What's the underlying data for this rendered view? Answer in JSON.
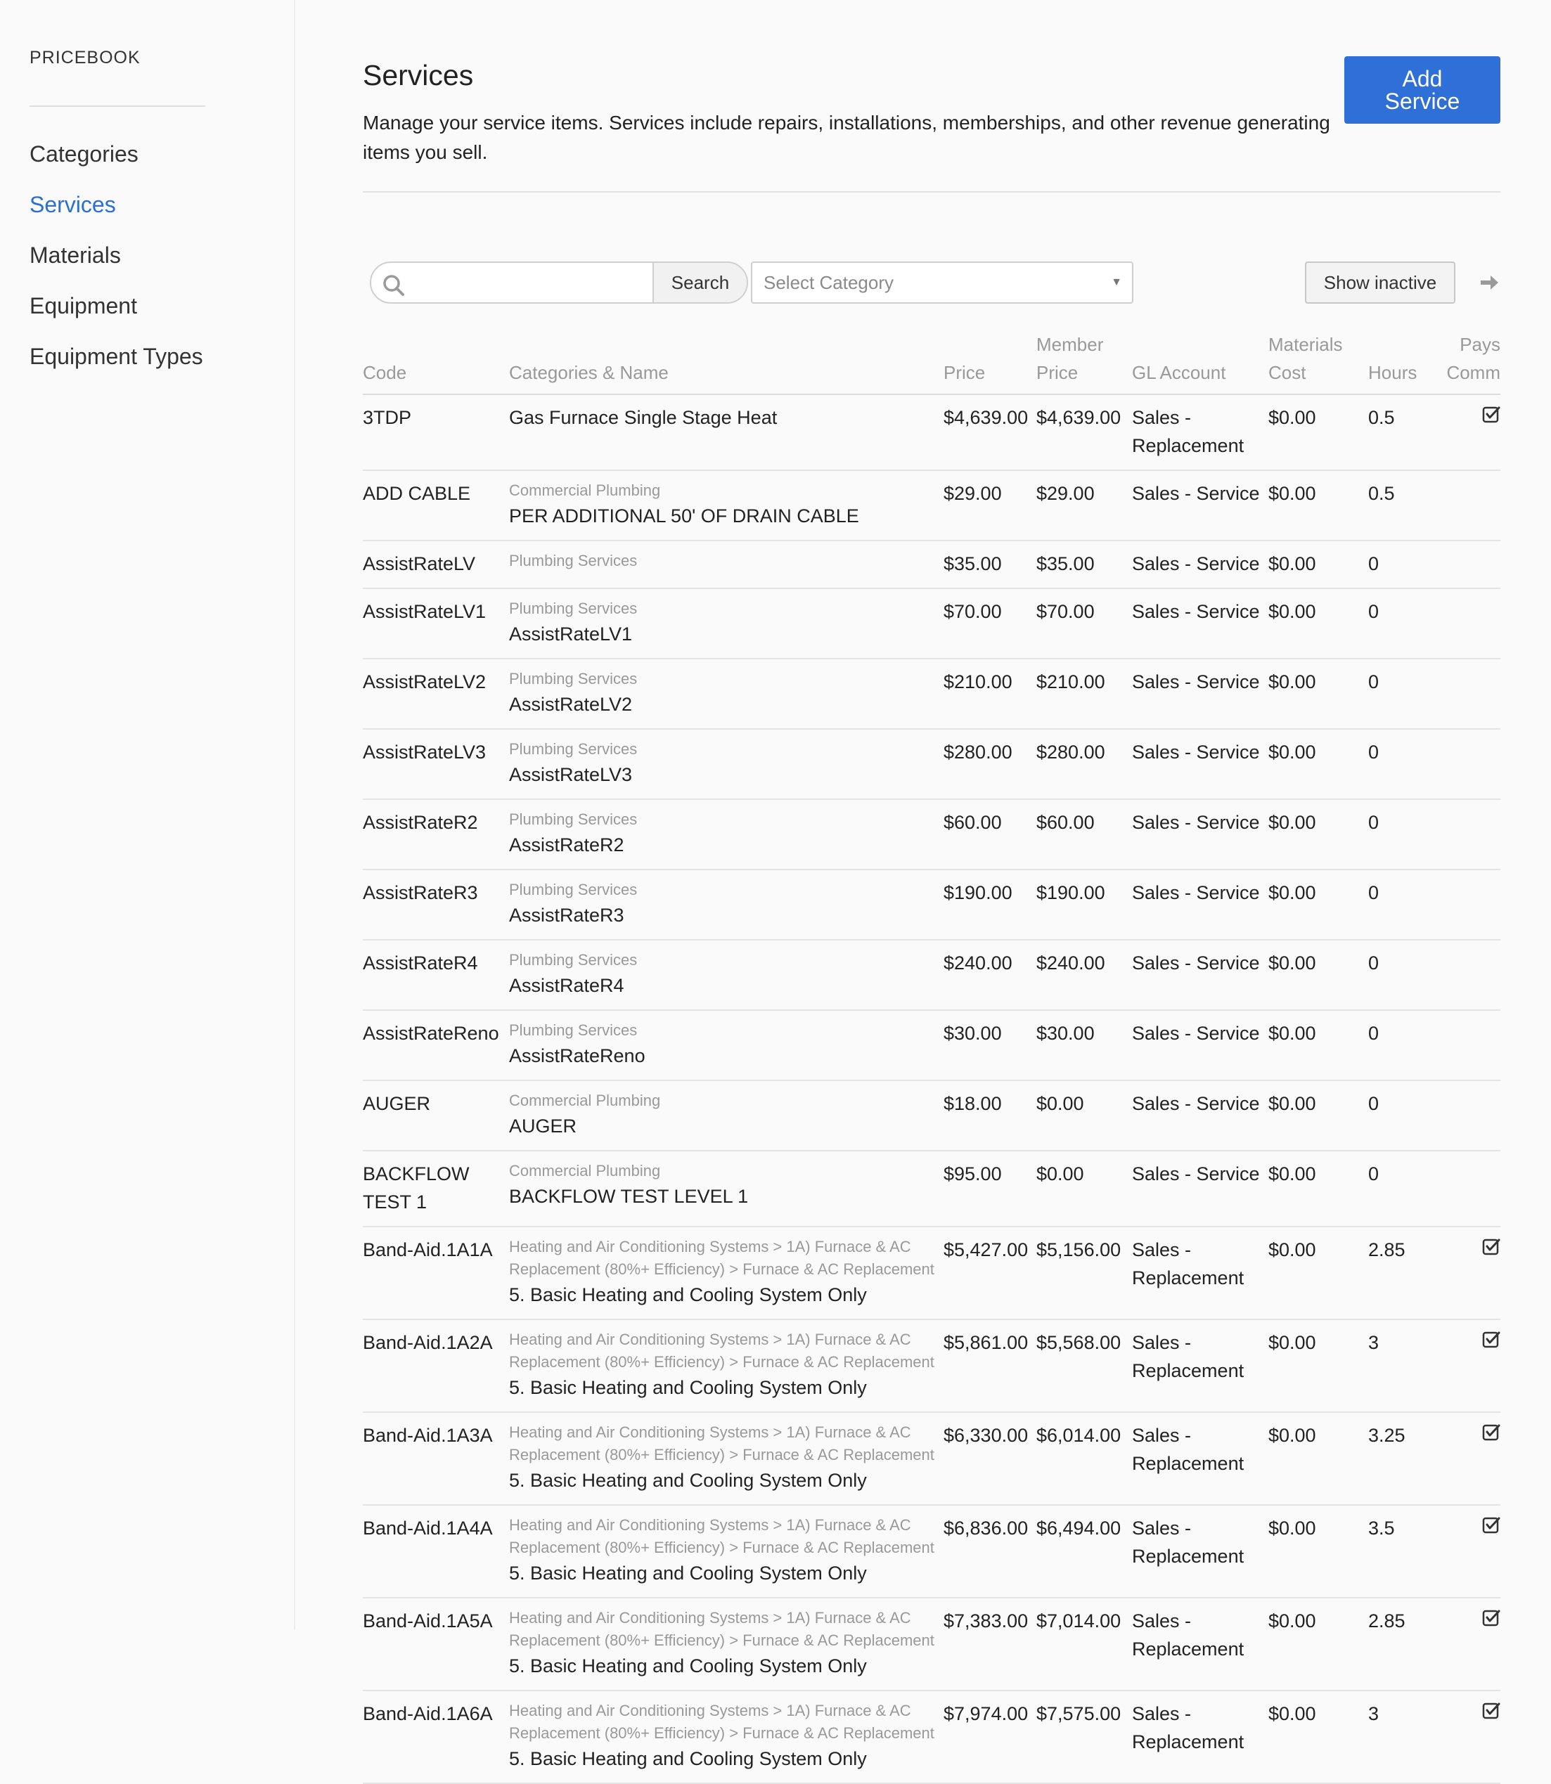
{
  "sidebar": {
    "brand": "PRICEBOOK",
    "items": [
      {
        "label": "Categories",
        "active": false
      },
      {
        "label": "Services",
        "active": true
      },
      {
        "label": "Materials",
        "active": false
      },
      {
        "label": "Equipment",
        "active": false
      },
      {
        "label": "Equipment Types",
        "active": false
      }
    ]
  },
  "header": {
    "title": "Services",
    "description": "Manage your service items. Services include repairs, installations, memberships, and other revenue generating items you sell.",
    "add_button": "Add Service"
  },
  "toolbar": {
    "search_value": "",
    "search_button": "Search",
    "category_placeholder": "Select Category",
    "show_inactive": "Show inactive"
  },
  "table": {
    "columns": {
      "code": "Code",
      "name": "Categories & Name",
      "price": "Price",
      "member_price": "Member Price",
      "gl_account": "GL Account",
      "materials_cost": "Materials Cost",
      "hours": "Hours",
      "pays_comm": "Pays Comm"
    },
    "rows": [
      {
        "code": "3TDP",
        "category": "",
        "name": "Gas Furnace Single Stage Heat",
        "price": "$4,639.00",
        "member": "$4,639.00",
        "gl": "Sales - Replacement",
        "mat": "$0.00",
        "hours": "0.5",
        "comm": true
      },
      {
        "code": "ADD CABLE",
        "category": "Commercial Plumbing",
        "name": "PER ADDITIONAL 50' OF DRAIN CABLE",
        "price": "$29.00",
        "member": "$29.00",
        "gl": "Sales - Service",
        "mat": "$0.00",
        "hours": "0.5",
        "comm": false
      },
      {
        "code": "AssistRateLV",
        "category": "Plumbing Services",
        "name": "",
        "price": "$35.00",
        "member": "$35.00",
        "gl": "Sales - Service",
        "mat": "$0.00",
        "hours": "0",
        "comm": false
      },
      {
        "code": "AssistRateLV1",
        "category": "Plumbing Services",
        "name": "AssistRateLV1",
        "price": "$70.00",
        "member": "$70.00",
        "gl": "Sales - Service",
        "mat": "$0.00",
        "hours": "0",
        "comm": false
      },
      {
        "code": "AssistRateLV2",
        "category": "Plumbing Services",
        "name": "AssistRateLV2",
        "price": "$210.00",
        "member": "$210.00",
        "gl": "Sales - Service",
        "mat": "$0.00",
        "hours": "0",
        "comm": false
      },
      {
        "code": "AssistRateLV3",
        "category": "Plumbing Services",
        "name": "AssistRateLV3",
        "price": "$280.00",
        "member": "$280.00",
        "gl": "Sales - Service",
        "mat": "$0.00",
        "hours": "0",
        "comm": false
      },
      {
        "code": "AssistRateR2",
        "category": "Plumbing Services",
        "name": "AssistRateR2",
        "price": "$60.00",
        "member": "$60.00",
        "gl": "Sales - Service",
        "mat": "$0.00",
        "hours": "0",
        "comm": false
      },
      {
        "code": "AssistRateR3",
        "category": "Plumbing Services",
        "name": "AssistRateR3",
        "price": "$190.00",
        "member": "$190.00",
        "gl": "Sales - Service",
        "mat": "$0.00",
        "hours": "0",
        "comm": false
      },
      {
        "code": "AssistRateR4",
        "category": "Plumbing Services",
        "name": "AssistRateR4",
        "price": "$240.00",
        "member": "$240.00",
        "gl": "Sales - Service",
        "mat": "$0.00",
        "hours": "0",
        "comm": false
      },
      {
        "code": "AssistRateReno",
        "category": "Plumbing Services",
        "name": "AssistRateReno",
        "price": "$30.00",
        "member": "$30.00",
        "gl": "Sales - Service",
        "mat": "$0.00",
        "hours": "0",
        "comm": false
      },
      {
        "code": "AUGER",
        "category": "Commercial Plumbing",
        "name": "AUGER",
        "price": "$18.00",
        "member": "$0.00",
        "gl": "Sales - Service",
        "mat": "$0.00",
        "hours": "0",
        "comm": false
      },
      {
        "code": "BACKFLOW TEST 1",
        "category": "Commercial Plumbing",
        "name": "BACKFLOW TEST LEVEL 1",
        "price": "$95.00",
        "member": "$0.00",
        "gl": "Sales - Service",
        "mat": "$0.00",
        "hours": "0",
        "comm": false
      },
      {
        "code": "Band-Aid.1A1A",
        "category": "Heating and Air Conditioning Systems > 1A) Furnace & AC Replacement (80%+ Efficiency) > Furnace & AC Replacement",
        "name": "5. Basic Heating and Cooling System Only",
        "price": "$5,427.00",
        "member": "$5,156.00",
        "gl": "Sales - Replacement",
        "mat": "$0.00",
        "hours": "2.85",
        "comm": true
      },
      {
        "code": "Band-Aid.1A2A",
        "category": "Heating and Air Conditioning Systems > 1A) Furnace & AC Replacement (80%+ Efficiency) > Furnace & AC Replacement",
        "name": "5. Basic Heating and Cooling System Only",
        "price": "$5,861.00",
        "member": "$5,568.00",
        "gl": "Sales - Replacement",
        "mat": "$0.00",
        "hours": "3",
        "comm": true
      },
      {
        "code": "Band-Aid.1A3A",
        "category": "Heating and Air Conditioning Systems > 1A) Furnace & AC Replacement (80%+ Efficiency) > Furnace & AC Replacement",
        "name": "5. Basic Heating and Cooling System Only",
        "price": "$6,330.00",
        "member": "$6,014.00",
        "gl": "Sales - Replacement",
        "mat": "$0.00",
        "hours": "3.25",
        "comm": true
      },
      {
        "code": "Band-Aid.1A4A",
        "category": "Heating and Air Conditioning Systems > 1A) Furnace & AC Replacement (80%+ Efficiency) > Furnace & AC Replacement",
        "name": "5. Basic Heating and Cooling System Only",
        "price": "$6,836.00",
        "member": "$6,494.00",
        "gl": "Sales - Replacement",
        "mat": "$0.00",
        "hours": "3.5",
        "comm": true
      },
      {
        "code": "Band-Aid.1A5A",
        "category": "Heating and Air Conditioning Systems > 1A) Furnace & AC Replacement (80%+ Efficiency) > Furnace & AC Replacement",
        "name": "5. Basic Heating and Cooling System Only",
        "price": "$7,383.00",
        "member": "$7,014.00",
        "gl": "Sales - Replacement",
        "mat": "$0.00",
        "hours": "2.85",
        "comm": true
      },
      {
        "code": "Band-Aid.1A6A",
        "category": "Heating and Air Conditioning Systems > 1A) Furnace & AC Replacement (80%+ Efficiency) > Furnace & AC Replacement",
        "name": "5. Basic Heating and Cooling System Only",
        "price": "$7,974.00",
        "member": "$7,575.00",
        "gl": "Sales - Replacement",
        "mat": "$0.00",
        "hours": "3",
        "comm": true
      }
    ]
  }
}
